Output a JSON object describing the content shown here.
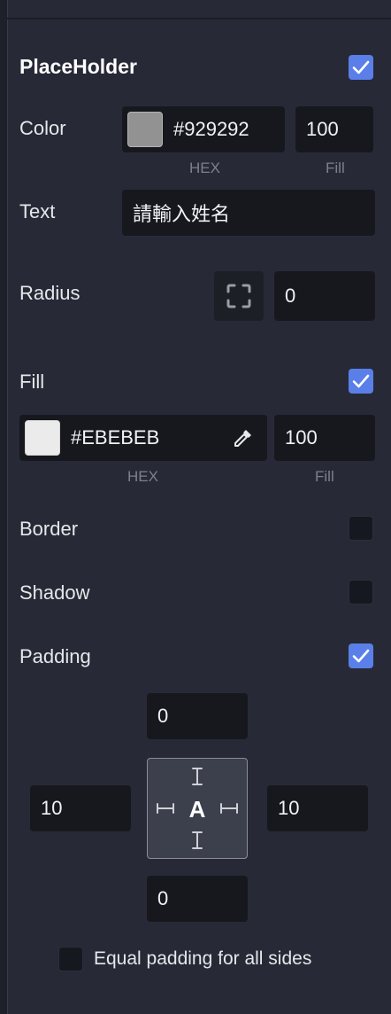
{
  "placeholder": {
    "title": "PlaceHolder",
    "enabled": true,
    "color": {
      "label": "Color",
      "swatch": "#929292",
      "hex": "#929292",
      "fill": "100",
      "hex_caption": "HEX",
      "fill_caption": "Fill"
    },
    "text": {
      "label": "Text",
      "value": "請輸入姓名"
    }
  },
  "radius": {
    "label": "Radius",
    "icon": "corners-icon",
    "value": "0"
  },
  "fill": {
    "label": "Fill",
    "enabled": true,
    "swatch": "#EBEBEB",
    "hex": "#EBEBEB",
    "value": "100",
    "hex_caption": "HEX",
    "fill_caption": "Fill",
    "icon": "eyedropper-icon"
  },
  "border": {
    "label": "Border",
    "enabled": false
  },
  "shadow": {
    "label": "Shadow",
    "enabled": false
  },
  "padding": {
    "label": "Padding",
    "enabled": true,
    "top": "0",
    "left": "10",
    "right": "10",
    "bottom": "0",
    "center_glyph": "A",
    "equal_label": "Equal padding for all sides",
    "equal_enabled": false
  },
  "colors": {
    "accent": "#5a7fe9",
    "panel": "#272a36",
    "field": "#16181e"
  }
}
